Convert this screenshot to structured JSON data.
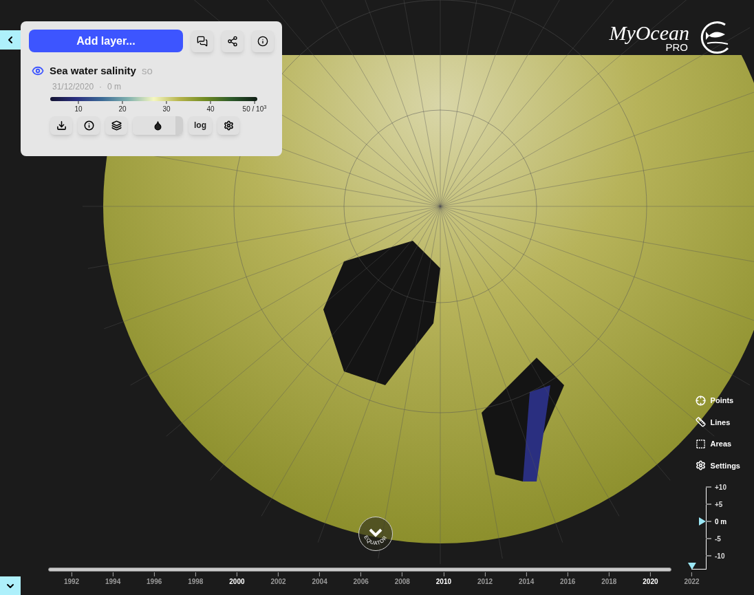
{
  "panel": {
    "add_layer": "Add layer...",
    "layer": {
      "name": "Sea water salinity",
      "code": "so",
      "visible": true,
      "date": "31/12/2020",
      "separator": "·",
      "depth": "0 m",
      "colorbar": {
        "ticks": [
          "10",
          "20",
          "30",
          "40",
          "50 / 10$^{3}$"
        ]
      },
      "log_label": "log"
    }
  },
  "logo": {
    "script": "MyOcean",
    "sub": "PRO"
  },
  "tools": [
    {
      "kind": "points",
      "label": "Points"
    },
    {
      "kind": "lines",
      "label": "Lines"
    },
    {
      "kind": "areas",
      "label": "Areas"
    },
    {
      "kind": "settings",
      "label": "Settings"
    }
  ],
  "depth_scale": [
    {
      "label": "+10",
      "selected": false
    },
    {
      "label": "+5",
      "selected": false
    },
    {
      "label": "0 m",
      "selected": true
    },
    {
      "label": "-5",
      "selected": false
    },
    {
      "label": "-10",
      "selected": false
    }
  ],
  "equator": "EQUATOR",
  "timeline": [
    {
      "year": "1992",
      "major": false,
      "selected": false
    },
    {
      "year": "1994",
      "major": false,
      "selected": false
    },
    {
      "year": "1996",
      "major": false,
      "selected": false
    },
    {
      "year": "1998",
      "major": false,
      "selected": false
    },
    {
      "year": "2000",
      "major": true,
      "selected": false
    },
    {
      "year": "2002",
      "major": false,
      "selected": false
    },
    {
      "year": "2004",
      "major": false,
      "selected": false
    },
    {
      "year": "2006",
      "major": false,
      "selected": false
    },
    {
      "year": "2008",
      "major": false,
      "selected": false
    },
    {
      "year": "2010",
      "major": true,
      "selected": false
    },
    {
      "year": "2012",
      "major": false,
      "selected": false
    },
    {
      "year": "2014",
      "major": false,
      "selected": false
    },
    {
      "year": "2016",
      "major": false,
      "selected": false
    },
    {
      "year": "2018",
      "major": false,
      "selected": false
    },
    {
      "year": "2020",
      "major": true,
      "selected": false
    },
    {
      "year": "2022",
      "major": false,
      "selected": true
    }
  ]
}
